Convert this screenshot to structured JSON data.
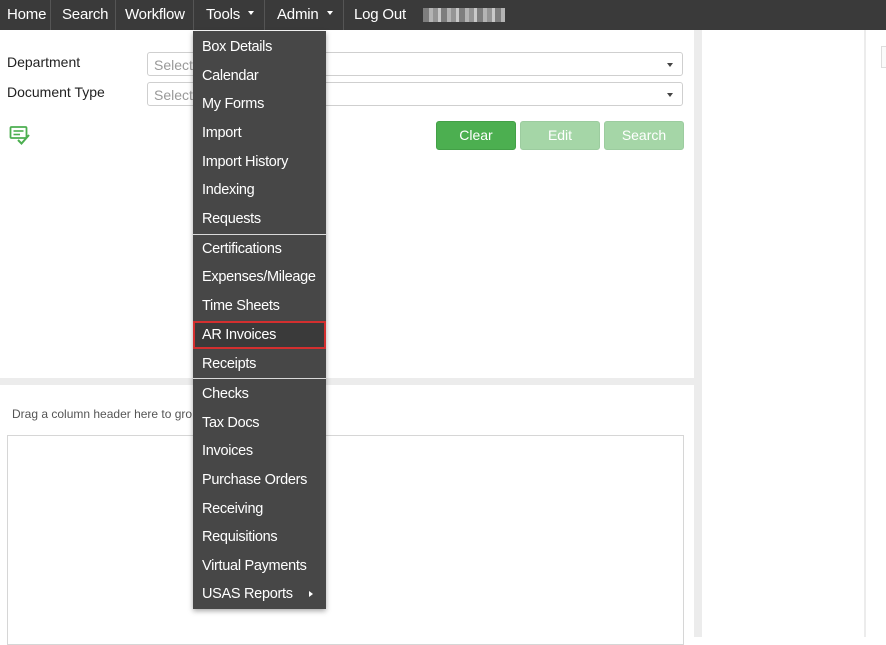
{
  "navbar": {
    "items": [
      {
        "label": "Home"
      },
      {
        "label": "Search"
      },
      {
        "label": "Workflow"
      },
      {
        "label": "Tools"
      },
      {
        "label": "Admin"
      },
      {
        "label": "Log Out"
      }
    ]
  },
  "search": {
    "department_label": "Department",
    "department_placeholder": "Select",
    "doctype_label": "Document Type",
    "doctype_placeholder": "Select",
    "clear_label": "Clear",
    "edit_label": "Edit",
    "search_label": "Search"
  },
  "grid": {
    "group_hint": "Drag a column header here to gro"
  },
  "tools_menu": {
    "items": [
      {
        "label": "Box Details"
      },
      {
        "label": "Calendar"
      },
      {
        "label": "My Forms"
      },
      {
        "label": "Import"
      },
      {
        "label": "Import History"
      },
      {
        "label": "Indexing"
      },
      {
        "label": "Requests"
      },
      {
        "label": "Certifications"
      },
      {
        "label": "Expenses/Mileage"
      },
      {
        "label": "Time Sheets"
      },
      {
        "label": "AR Invoices"
      },
      {
        "label": "Receipts"
      },
      {
        "label": "Checks"
      },
      {
        "label": "Tax Docs"
      },
      {
        "label": "Invoices"
      },
      {
        "label": "Purchase Orders"
      },
      {
        "label": "Receiving"
      },
      {
        "label": "Requisitions"
      },
      {
        "label": "Virtual Payments"
      },
      {
        "label": "USAS Reports"
      }
    ],
    "highlighted_item": "AR Invoices"
  },
  "colors": {
    "navbar_bg": "#3a3a3a",
    "menu_bg": "#474747",
    "primary_green": "#4caf50",
    "disabled_green": "#a5d6a7",
    "highlight_border": "#d32f2f"
  }
}
